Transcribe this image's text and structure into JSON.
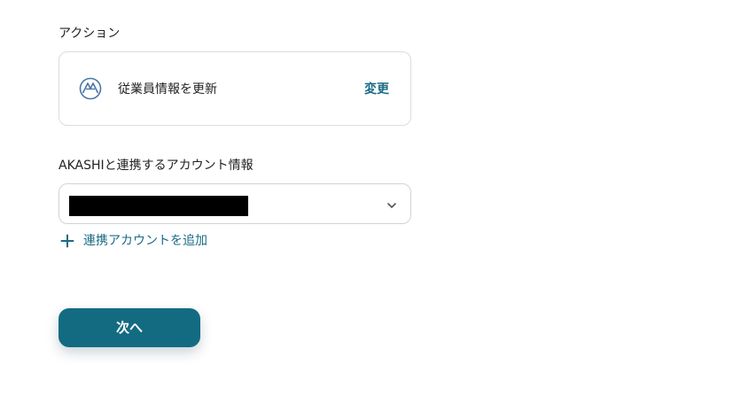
{
  "action_section": {
    "label": "アクション",
    "app_icon": "akashi-logo-icon",
    "action_name": "従業員情報を更新",
    "change_label": "変更"
  },
  "account_section": {
    "label": "AKASHIと連携するアカウント情報",
    "selected_value": "",
    "add_account_label": "連携アカウントを追加"
  },
  "footer": {
    "next_label": "次へ"
  },
  "colors": {
    "accent": "#1a6b85",
    "button_bg": "#136b82",
    "border": "#d9dde1"
  }
}
